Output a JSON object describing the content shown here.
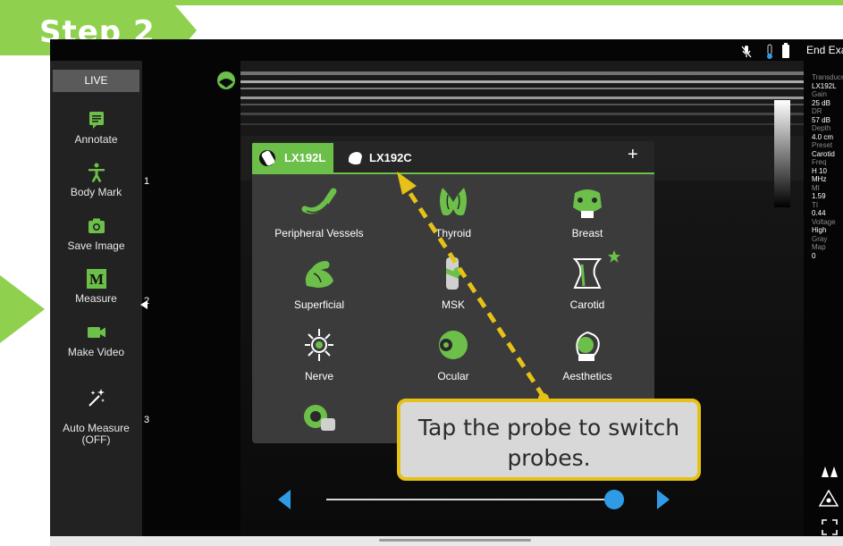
{
  "banner": {
    "step_label": "Step 2"
  },
  "sidebar": {
    "live_label": "LIVE",
    "tools": [
      {
        "label": "Annotate",
        "icon": "annotate-icon"
      },
      {
        "label": "Body Mark",
        "icon": "body-mark-icon"
      },
      {
        "label": "Save Image",
        "icon": "camera-icon"
      },
      {
        "label": "Measure",
        "icon": "measure-icon"
      },
      {
        "label": "Make Video",
        "icon": "video-camera-icon"
      },
      {
        "label": "Auto Measure\n(OFF)",
        "icon": "auto-measure-sparkle-icon"
      }
    ]
  },
  "status_bar": {
    "end_exam_label": "End Exam"
  },
  "depth_ruler": {
    "marks": [
      "1",
      "2",
      "3"
    ]
  },
  "parameters": [
    {
      "key": "Transducer",
      "value": "LX192L"
    },
    {
      "key": "Gain",
      "value": "25 dB"
    },
    {
      "key": "DR",
      "value": "57 dB"
    },
    {
      "key": "Depth",
      "value": "4.0 cm"
    },
    {
      "key": "Preset",
      "value": "Carotid"
    },
    {
      "key": "Freq",
      "value": "H 10 MHz"
    },
    {
      "key": "MI",
      "value": "1.59"
    },
    {
      "key": "TI",
      "value": "0.44"
    },
    {
      "key": "Voltage",
      "value": "High"
    },
    {
      "key": "Gray Map",
      "value": "0"
    }
  ],
  "probe_popup": {
    "tabs": [
      {
        "label": "LX192L",
        "active": true
      },
      {
        "label": "LX192C",
        "active": false
      }
    ],
    "add_label": "+",
    "presets": [
      {
        "label": "Peripheral Vessels",
        "icon": "peripheral-vessels-icon"
      },
      {
        "label": "Thyroid",
        "icon": "thyroid-icon"
      },
      {
        "label": "Breast",
        "icon": "breast-icon"
      },
      {
        "label": "Superficial",
        "icon": "superficial-arm-icon"
      },
      {
        "label": "MSK",
        "icon": "msk-knee-icon"
      },
      {
        "label": "Carotid",
        "icon": "carotid-neck-icon",
        "favorite": true
      },
      {
        "label": "Nerve",
        "icon": "nerve-icon"
      },
      {
        "label": "Ocular",
        "icon": "ocular-eye-icon"
      },
      {
        "label": "Aesthetics",
        "icon": "aesthetics-face-icon"
      },
      {
        "label": "",
        "icon": "custom-preset-icon"
      }
    ]
  },
  "callout": {
    "text": "Tap the probe to switch probes."
  },
  "playback": {
    "progress": 0.97
  },
  "colors": {
    "accent_green": "#6cc04a",
    "banner_green": "#8fd14f",
    "callout_border": "#e6c218",
    "playback_blue": "#2f9be6"
  }
}
